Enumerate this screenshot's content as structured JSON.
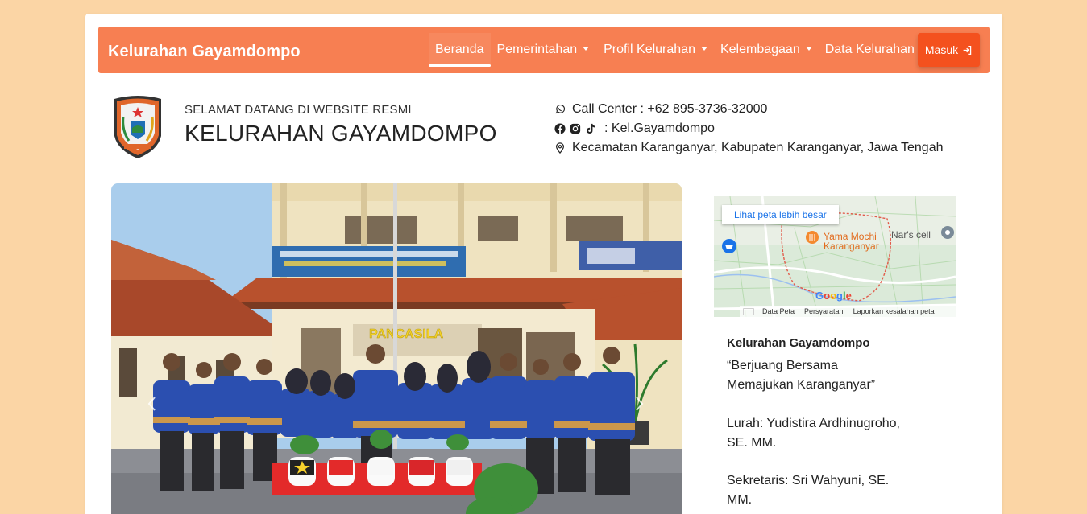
{
  "navbar": {
    "brand": "Kelurahan Gayamdompo",
    "items": [
      {
        "label": "Beranda",
        "active": true,
        "dropdown": false
      },
      {
        "label": "Pemerintahan",
        "active": false,
        "dropdown": true
      },
      {
        "label": "Profil Kelurahan",
        "active": false,
        "dropdown": true
      },
      {
        "label": "Kelembagaan",
        "active": false,
        "dropdown": true
      },
      {
        "label": "Data Kelurahan",
        "active": false,
        "dropdown": false
      }
    ],
    "login_label": "Masuk",
    "color": "#f77f52",
    "login_color": "#f4511e"
  },
  "header": {
    "welcome": "SELAMAT DATANG DI WEBSITE RESMI",
    "title": "KELURAHAN GAYAMDOMPO",
    "call_center": "Call Center : +62 895-3736-32000",
    "social": ": Kel.Gayamdompo",
    "address": "Kecamatan Karanganyar, Kabupaten Karanganyar, Jawa Tengah",
    "icons": [
      "whatsapp-icon",
      "facebook-icon",
      "instagram-icon",
      "tiktok-icon",
      "map-pin-icon"
    ]
  },
  "hero": {
    "banner_text": "PANCASILA",
    "icons": [
      "carousel-prev-icon",
      "carousel-next-icon"
    ]
  },
  "map": {
    "link": "Lihat peta lebih besar",
    "place": "Yama Mochi Karanganyar",
    "place2": "Nar's cell",
    "footer": [
      "Data Peta",
      "Persyaratan",
      "Laporkan kesalahan peta"
    ],
    "brand": "Google"
  },
  "info": {
    "name": "Kelurahan Gayamdompo",
    "motto": "“Berjuang Bersama Memajukan Karanganyar”",
    "lurah": "Lurah: Yudistira Ardhinugroho, SE. MM.",
    "sekretaris": "Sekretaris: Sri Wahyuni, SE. MM."
  },
  "colors": {
    "background": "#fbd5a5",
    "accent": "#f77f52"
  }
}
